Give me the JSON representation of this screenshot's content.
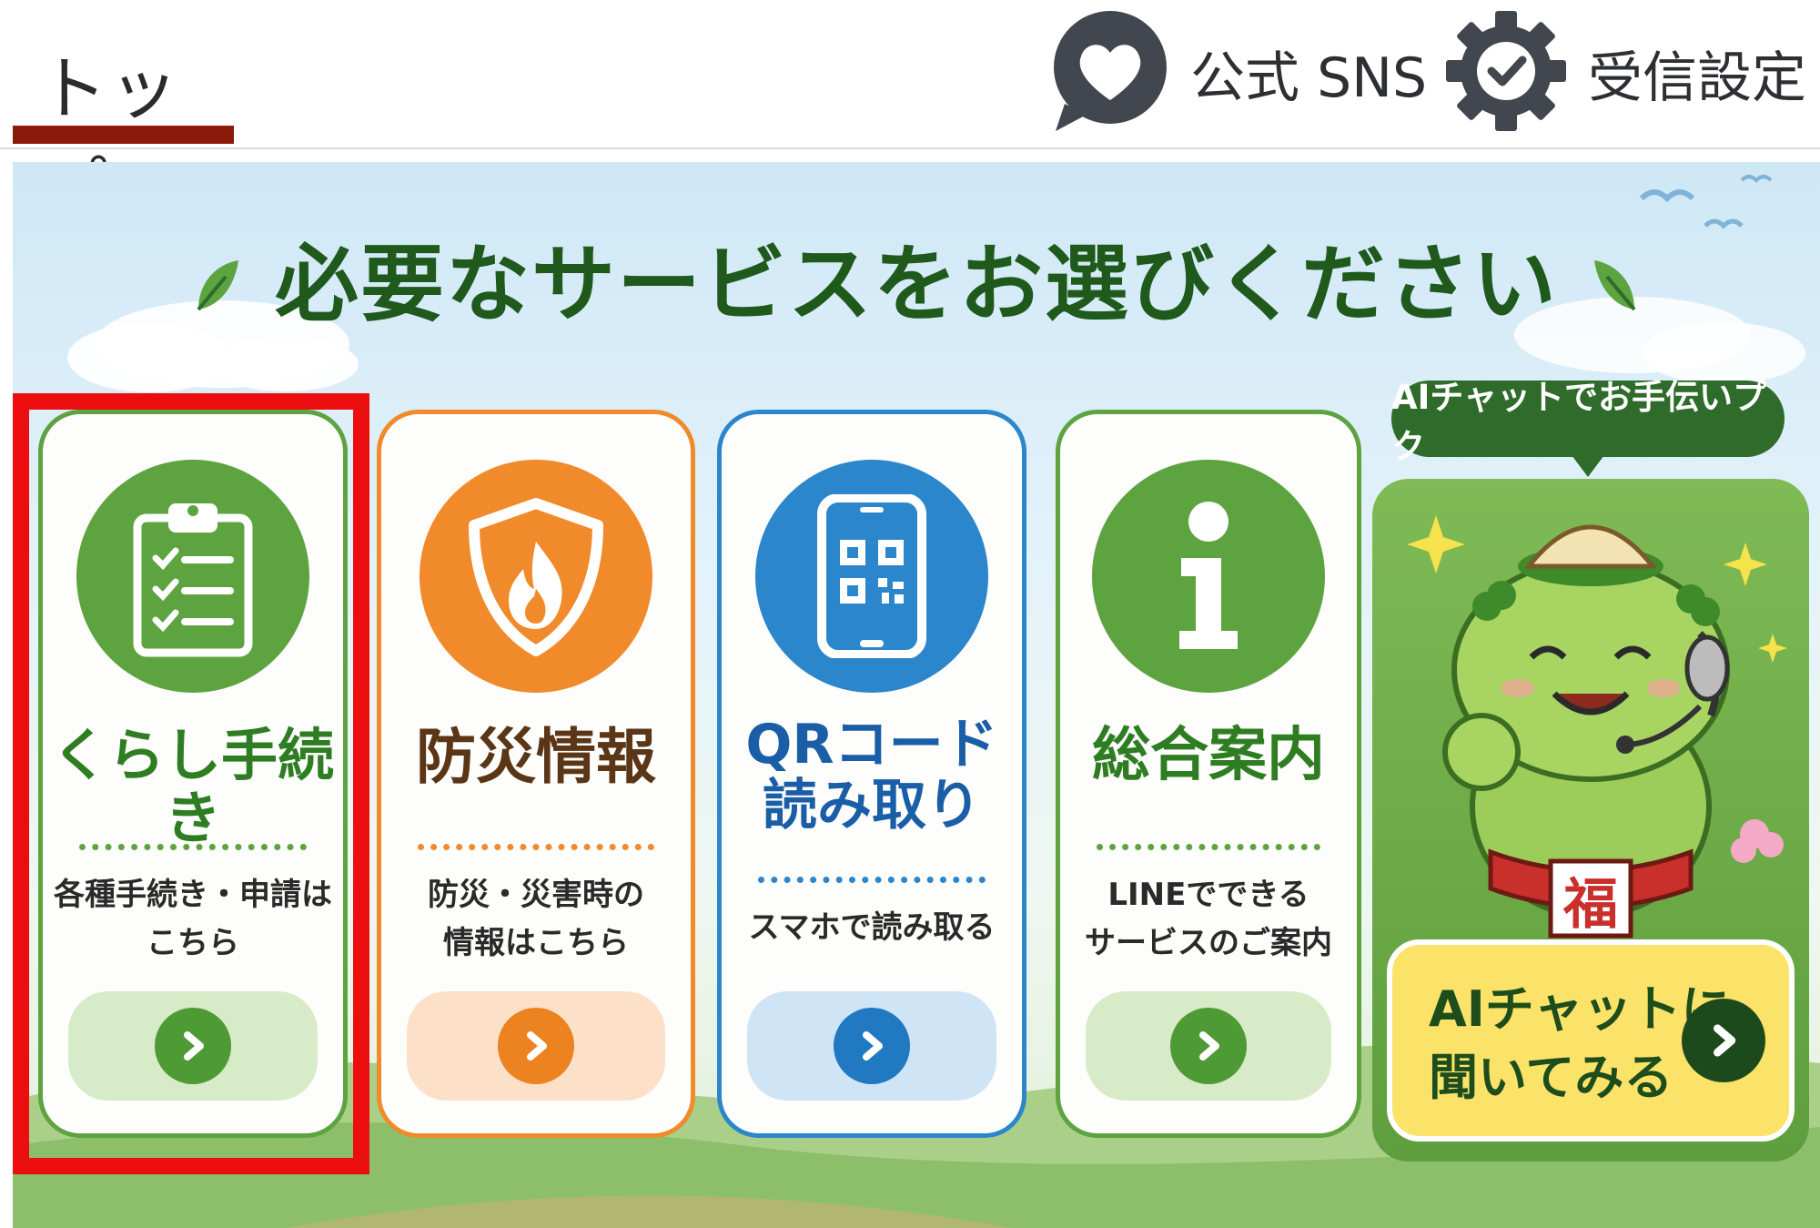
{
  "header": {
    "tab_top_label": "トップ",
    "sns_label": "公式 SNS",
    "settings_label": "受信設定"
  },
  "banner": {
    "headline": "必要なサービスをお選びください",
    "cards": [
      {
        "title": "くらし手続き",
        "desc_line1": "各種手続き・申請は",
        "desc_line2": "こちら",
        "icon": "clipboard-checklist-icon",
        "color": "#5da33f"
      },
      {
        "title": "防災情報",
        "desc_line1": "防災・災害時の",
        "desc_line2": "情報はこちら",
        "icon": "shield-fire-icon",
        "color": "#f08a2a"
      },
      {
        "title_line1": "QRコード",
        "title_line2": "読み取り",
        "desc_line1": "スマホで読み取る",
        "icon": "phone-qr-icon",
        "color": "#2b86cc"
      },
      {
        "title": "総合案内",
        "desc_line1": "LINEでできる",
        "desc_line2": "サービスのご案内",
        "icon": "info-icon",
        "color": "#5da33f"
      }
    ],
    "ai": {
      "bubble": "AIチャットでお手伝いプク",
      "mascot_badge": "福",
      "button_line1": "AIチャットに",
      "button_line2": "聞いてみる",
      "color": "#1e4d1c"
    }
  },
  "highlight_color": "#ec0e0e"
}
